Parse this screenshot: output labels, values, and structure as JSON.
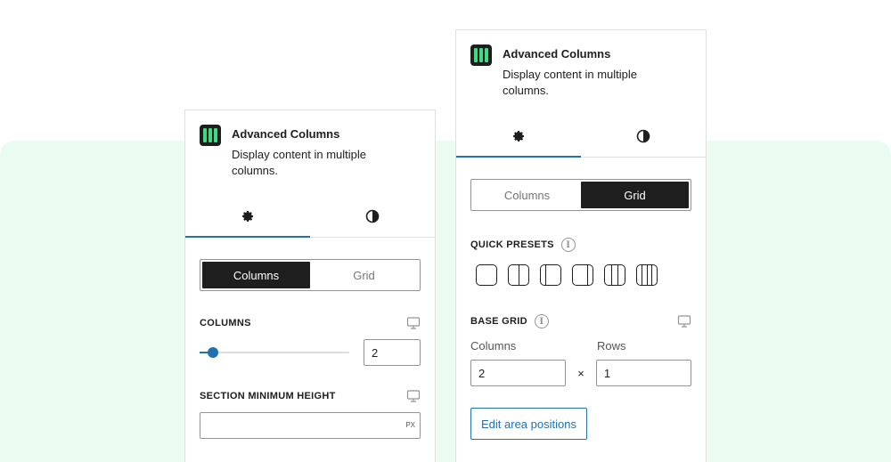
{
  "left_panel": {
    "block_title": "Advanced Columns",
    "block_description": "Display content in multiple columns.",
    "tabs": [
      {
        "icon": "gear-icon"
      },
      {
        "icon": "contrast-icon"
      }
    ],
    "mode_options": [
      "Columns",
      "Grid"
    ],
    "active_mode": "Columns",
    "columns_label": "COLUMNS",
    "columns_value": "2",
    "columns_slider_fraction": 0.09,
    "min_height_label": "SECTION MINIMUM HEIGHT",
    "min_height_value": "",
    "min_height_unit": "PX"
  },
  "right_panel": {
    "block_title": "Advanced Columns",
    "block_description": "Display content in multiple columns.",
    "tabs": [
      {
        "icon": "gear-icon"
      },
      {
        "icon": "contrast-icon"
      }
    ],
    "mode_options": [
      "Columns",
      "Grid"
    ],
    "active_mode": "Grid",
    "quick_presets_label": "QUICK PRESETS",
    "presets": [
      1,
      2,
      2,
      2,
      3,
      4
    ],
    "base_grid_label": "BASE GRID",
    "columns_label": "Columns",
    "rows_label": "Rows",
    "columns_value": "2",
    "rows_value": "1",
    "times_symbol": "×",
    "edit_button_label": "Edit area positions"
  },
  "colors": {
    "accent": "#2271b1",
    "brand_green": "#3ddc84",
    "background_mint": "#eafbf1"
  }
}
